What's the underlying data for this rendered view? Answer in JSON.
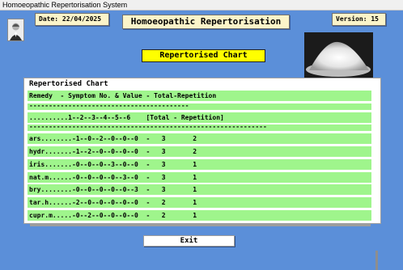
{
  "window": {
    "title": "Homoeopathic Repertorisation System"
  },
  "header": {
    "date_label": "Date: 22/04/2025",
    "app_title": "Homoeopathic Repertorisation",
    "version_label": "Version: 15"
  },
  "subtitle": "Repertorised Chart",
  "chart": {
    "title": "Repertorised Chart",
    "rows": [
      "Remedy  - Symptom No. & Value - Total-Repetition",
      "-----------------------------------------",
      "..........1--2--3--4--5--6    [Total - Repetition]",
      "-------------------------------------------------------------",
      "ars........-1--0--2--0--0--0  -   3       2",
      "hydr.......-1--2--0--0--0--0  -   3       2",
      "iris.......-0--0--0--3--0--0  -   3       1",
      "nat.m......-0--0--0--0--3--0  -   3       1",
      "bry........-0--0--0--0--0--3  -   3       1",
      "tar.h......-2--0--0--0--0--0  -   2       1",
      "cupr.m.....-0--2--0--0--0--0  -   2       1"
    ]
  },
  "buttons": {
    "exit": "Exit"
  },
  "icons": {
    "portrait": "portrait-icon",
    "powder": "powder-photo"
  },
  "colors": {
    "background": "#5b8fd9",
    "row_highlight": "#9ff58c",
    "subtitle_bg": "#ffff00",
    "header_box": "#fbf4c9"
  }
}
